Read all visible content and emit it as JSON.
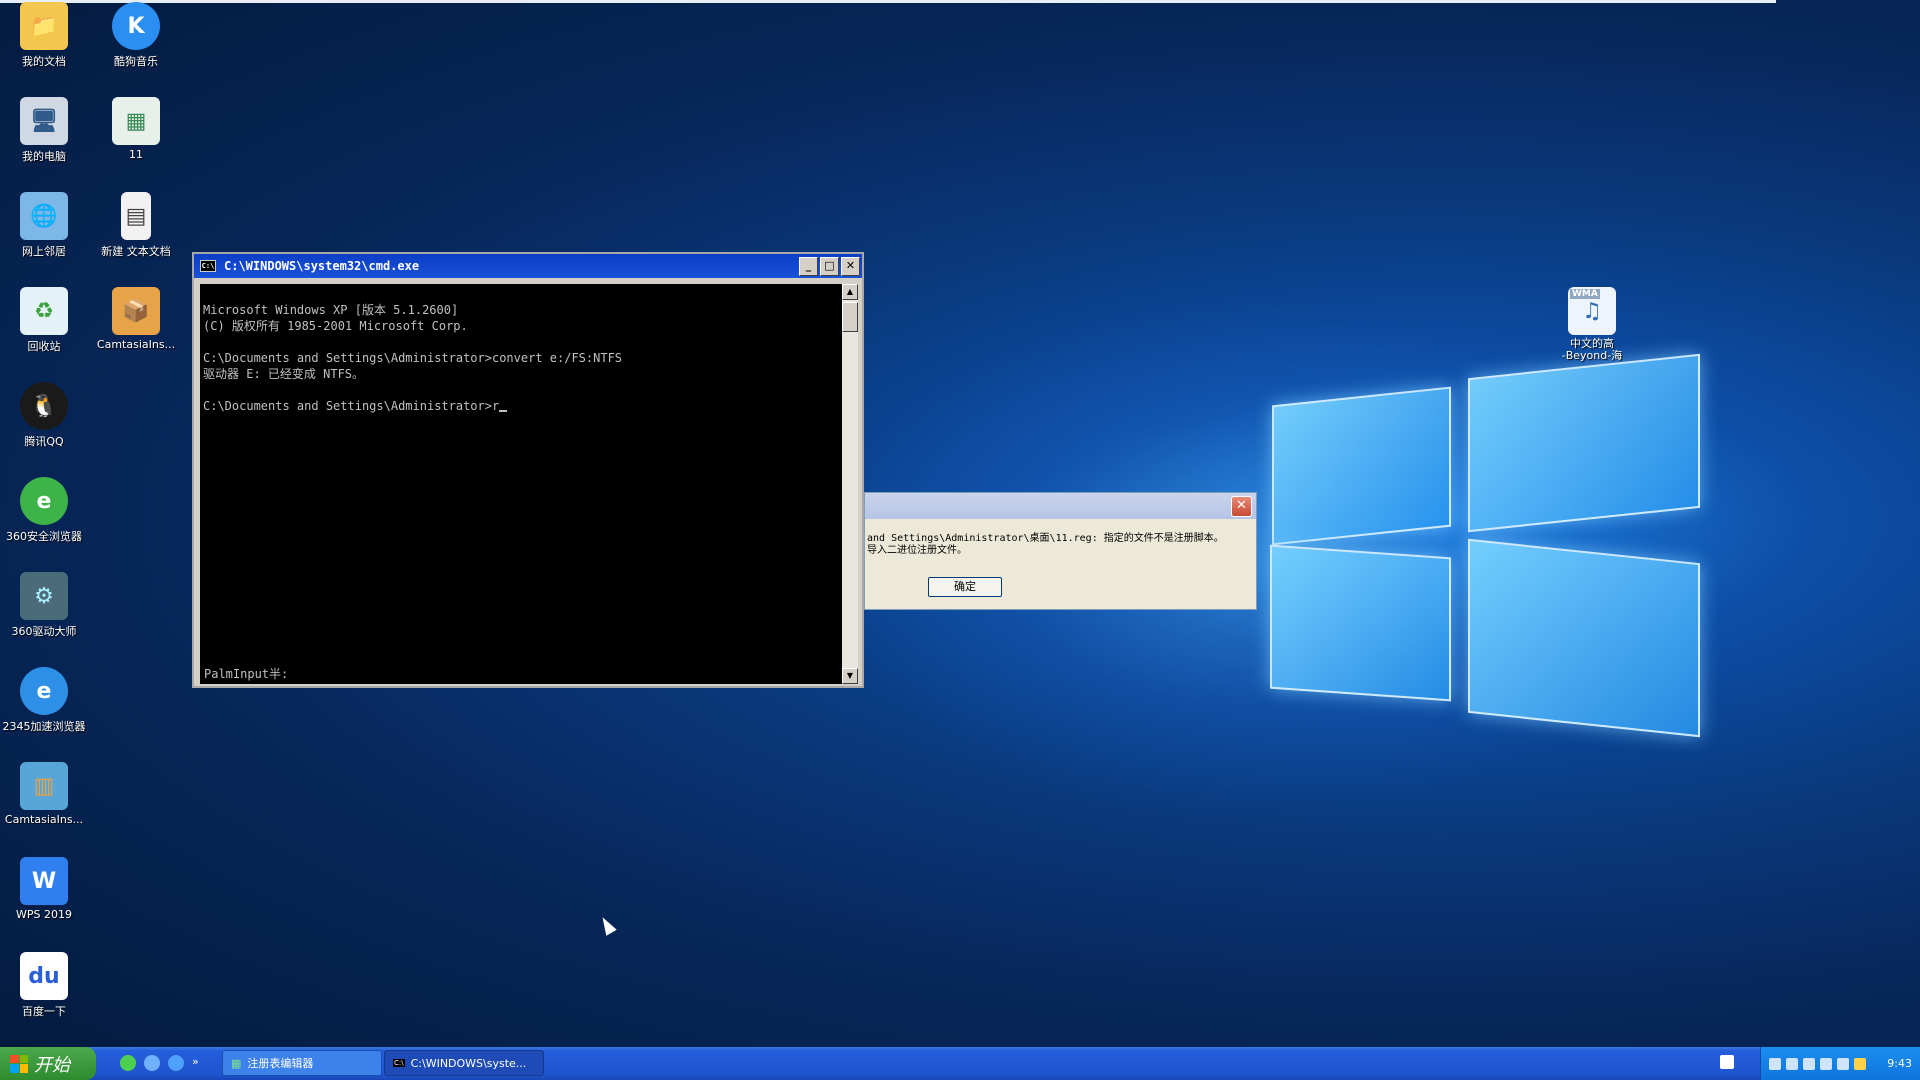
{
  "desktop": {
    "icons": [
      {
        "label": "我的文档",
        "glyph": "📁",
        "color": "#f3c64d"
      },
      {
        "label": "酷狗音乐",
        "glyph": "K",
        "color": "#2a8ff0"
      },
      {
        "label": "我的电脑",
        "glyph": "🖥",
        "color": "#cfd8e3"
      },
      {
        "label": "11",
        "glyph": "▦",
        "color": "#5aa66f"
      },
      {
        "label": "网上邻居",
        "glyph": "🌐",
        "color": "#7db7e8"
      },
      {
        "label": "新建 文本文档",
        "glyph": "▤",
        "color": "#f2f2f2"
      },
      {
        "label": "回收站",
        "glyph": "♻",
        "color": "#56b356"
      },
      {
        "label": "CamtasiaIns...",
        "glyph": "📦",
        "color": "#e6a348"
      },
      {
        "label": "腾讯QQ",
        "glyph": "🐧",
        "color": "#ffffff"
      },
      {
        "label": "360安全浏览器",
        "glyph": "e",
        "color": "#3db34a"
      },
      {
        "label": "360驱动大师",
        "glyph": "⚙",
        "color": "#4b6b7a"
      },
      {
        "label": "2345加速浏览器",
        "glyph": "e",
        "color": "#2e8fe6"
      },
      {
        "label": "CamtasiaIns...",
        "glyph": "▥",
        "color": "#58a6d8"
      },
      {
        "label": "WPS 2019",
        "glyph": "W",
        "color": "#2f7ff0"
      },
      {
        "label": "百度一下",
        "glyph": "du",
        "color": "#ffffff"
      },
      {
        "label": "中文的高\n-Beyond-海",
        "glyph": "♫",
        "color": "#eef4fb",
        "badge": "WMA"
      }
    ]
  },
  "cmd": {
    "title": "C:\\WINDOWS\\system32\\cmd.exe",
    "icon_text": "C:\\",
    "lines": [
      "Microsoft Windows XP [版本 5.1.2600]",
      "(C) 版权所有 1985-2001 Microsoft Corp.",
      "",
      "C:\\Documents and Settings\\Administrator>convert e:/FS:NTFS",
      "驱动器 E: 已经变成 NTFS。",
      "",
      "C:\\Documents and Settings\\Administrator>r"
    ],
    "ime_status": "PalmInput半:",
    "min": "_",
    "max": "□",
    "close": "✕"
  },
  "dialog": {
    "message_line1": "and Settings\\Administrator\\桌面\\11.reg: 指定的文件不是注册脚本。",
    "message_line2": "导入二进位注册文件。",
    "ok": "确定",
    "close": "✕"
  },
  "taskbar": {
    "start": "开始",
    "more": "»",
    "task1": "注册表编辑器",
    "task2": "C:\\WINDOWS\\syste...",
    "clock": "9:43"
  },
  "colors": {
    "accent": "#0a3ec6",
    "taskbar": "#245edb",
    "start": "#2e8b2e"
  }
}
